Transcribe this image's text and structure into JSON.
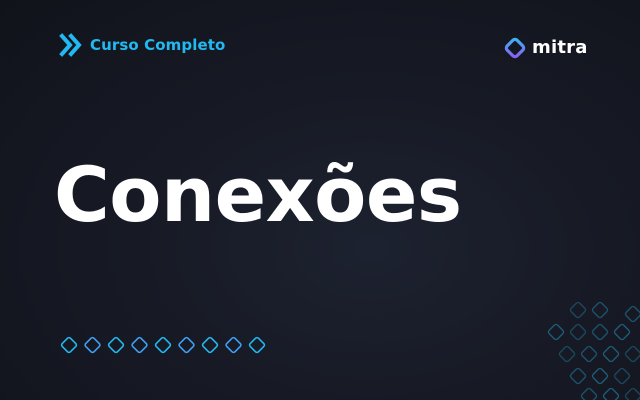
{
  "course_tag": {
    "label": "Curso Completo",
    "icon": "double-chevron-right-icon"
  },
  "brand": {
    "name": "mitra",
    "icon": "diamond-logo-icon"
  },
  "title": "Conexões",
  "decorations": {
    "row_diamond_count": 9,
    "pattern_icon": "diamond-grid-pattern"
  },
  "colors": {
    "background": "#171a25",
    "accent": "#22b8f0",
    "accent_secondary": "#3ea0f5",
    "brand_gradient_start": "#3ab7f2",
    "brand_gradient_end": "#8b5cf6",
    "title": "#ffffff"
  }
}
